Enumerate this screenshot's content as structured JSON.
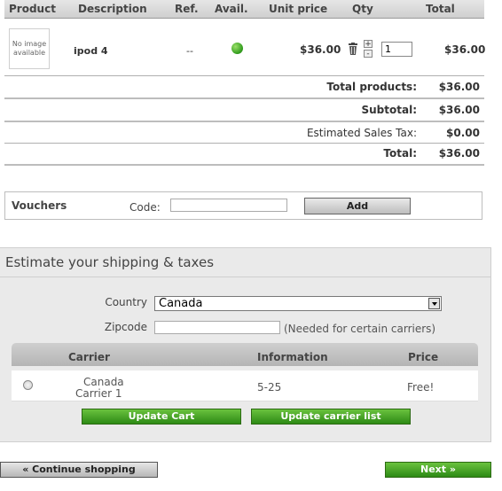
{
  "cart": {
    "headers": {
      "product": "Product",
      "description": "Description",
      "ref": "Ref.",
      "avail": "Avail.",
      "unit_price": "Unit price",
      "qty": "Qty",
      "total": "Total"
    },
    "item": {
      "no_image_text": "No image available",
      "description": "ipod 4",
      "ref": "--",
      "availability": "in-stock",
      "unit_price": "$36.00",
      "qty_increase": "+",
      "qty_decrease": "-",
      "quantity": "1",
      "total": "$36.00"
    },
    "summary": {
      "total_products_label": "Total products:",
      "total_products": "$36.00",
      "subtotal_label": "Subtotal:",
      "subtotal": "$36.00",
      "tax_label": "Estimated Sales Tax:",
      "tax": "$0.00",
      "total_label": "Total:",
      "total": "$36.00"
    }
  },
  "vouchers": {
    "title": "Vouchers",
    "code_label": "Code:",
    "code_value": "",
    "add_label": "Add"
  },
  "shipping": {
    "title": "Estimate your shipping & taxes",
    "country_label": "Country",
    "country_value": "Canada",
    "zipcode_label": "Zipcode",
    "zipcode_value": "",
    "zipcode_note": "(Needed for certain carriers)",
    "table_headers": {
      "carrier": "Carrier",
      "information": "Information",
      "price": "Price"
    },
    "carriers": [
      {
        "name_line1": "Canada",
        "name_line2": "Carrier 1",
        "information": "5-25",
        "price": "Free!",
        "selected": false
      }
    ],
    "update_cart_label": "Update Cart",
    "update_carrier_label": "Update carrier list"
  },
  "nav": {
    "continue_label": "« Continue shopping",
    "next_label": "Next »"
  },
  "colors": {
    "accent_green": "#2d8a15",
    "availability_green": "#2f9a1b"
  }
}
